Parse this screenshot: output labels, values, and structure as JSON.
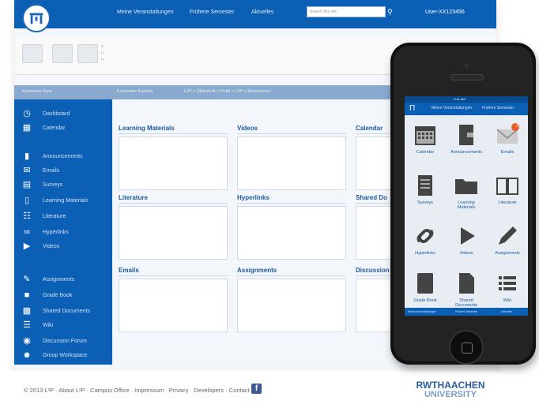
{
  "topnav": {
    "items": [
      "Meine Veranstaltungen",
      "Frühere Semester",
      "Aktuelles"
    ],
    "search_placeholder": "Search this site",
    "user": "User-XX123456"
  },
  "breadcrumb": [
    "Kursname Kurs",
    "Kursname Kurs/en",
    "L2P > Übersicht > Profil > L2P > Ressourcen"
  ],
  "sidebar": {
    "items": [
      {
        "label": "Dashboard",
        "icon": "dashboard-icon"
      },
      {
        "label": "Calendar",
        "icon": "calendar-icon"
      },
      {
        "label": "Announcements",
        "icon": "announcement-icon"
      },
      {
        "label": "Emails",
        "icon": "email-icon"
      },
      {
        "label": "Surveys",
        "icon": "survey-icon"
      },
      {
        "label": "Learning Materials",
        "icon": "folder-icon"
      },
      {
        "label": "Literature",
        "icon": "book-icon"
      },
      {
        "label": "Hyperlinks",
        "icon": "link-icon"
      },
      {
        "label": "Videos",
        "icon": "play-icon"
      },
      {
        "label": "Assignments",
        "icon": "pen-icon"
      },
      {
        "label": "Grade Book",
        "icon": "gradebook-icon"
      },
      {
        "label": "Shared Documents",
        "icon": "document-icon"
      },
      {
        "label": "Wiki",
        "icon": "list-icon"
      },
      {
        "label": "Discussion Forum",
        "icon": "chat-icon"
      },
      {
        "label": "Group Workspace",
        "icon": "group-icon"
      }
    ]
  },
  "panels": [
    {
      "title": "Learning Materials"
    },
    {
      "title": "Videos"
    },
    {
      "title": "Calendar"
    },
    {
      "title": "Literature"
    },
    {
      "title": "Hyperlinks"
    },
    {
      "title": "Shared Do"
    },
    {
      "title": "Emails"
    },
    {
      "title": "Assignments"
    },
    {
      "title": "Discussion"
    }
  ],
  "footer": {
    "links": "© 2013 L²P · About L²P · Campus Office · Impressum · Privacy · Developers · Contact",
    "brand": "RWTHAACHEN",
    "brand_sub": "UNIVERSITY"
  },
  "phone": {
    "status": "9:41 AM",
    "tabs": [
      "Meine Veranstaltungen",
      "Frühere Semester"
    ],
    "badge": "3",
    "grid": [
      {
        "label": "Calendar",
        "icon": "calendar-icon"
      },
      {
        "label": "Announcements",
        "icon": "announcement-icon"
      },
      {
        "label": "Emails",
        "icon": "email-icon"
      },
      {
        "label": "Surveys",
        "icon": "survey-icon"
      },
      {
        "label": "Learning Materials",
        "icon": "folder-icon"
      },
      {
        "label": "Literature",
        "icon": "book-icon"
      },
      {
        "label": "Hyperlinks",
        "icon": "link-icon"
      },
      {
        "label": "Videos",
        "icon": "play-icon"
      },
      {
        "label": "Assignments",
        "icon": "pen-icon"
      },
      {
        "label": "Grade Book",
        "icon": "gradebook-icon"
      },
      {
        "label": "Shared Documents",
        "icon": "document-icon"
      },
      {
        "label": "Wiki",
        "icon": "list-icon"
      }
    ],
    "foot": [
      "Meine Veranstaltungen",
      "Frühere Semester",
      "Aktuelles"
    ]
  },
  "colors": {
    "primary": "#0b5fb4",
    "accent": "#ee5a2a",
    "link": "#1a5aa0"
  }
}
